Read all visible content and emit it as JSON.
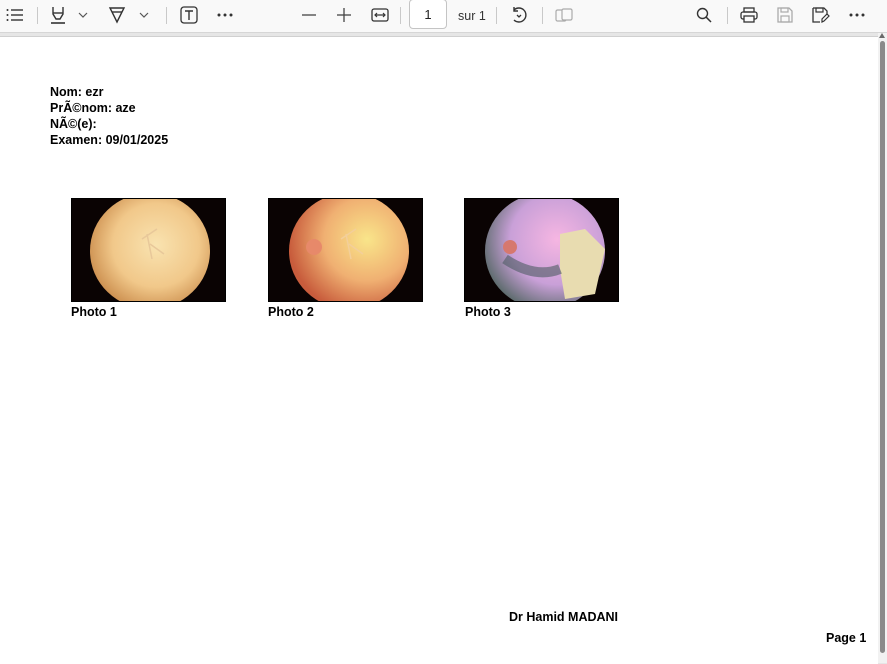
{
  "toolbar": {
    "icons": [
      "contents-icon",
      "highlight-icon",
      "chevron-down-icon",
      "draw-icon",
      "chevron-down-icon",
      "text-box-icon",
      "more-tools-icon",
      "zoom-out-icon",
      "zoom-in-icon",
      "fit-width-icon",
      "rotate-icon",
      "page-view-icon",
      "search-icon",
      "print-icon",
      "save-icon",
      "save-as-icon",
      "more-icon"
    ],
    "page_current": "1",
    "page_total_label": "sur 1"
  },
  "document": {
    "nom": "Nom: ezr",
    "prenom": "PrÃ©nom: aze",
    "ne": "NÃ©(e):",
    "examen": "Examen: 09/01/2025",
    "photos": [
      {
        "caption": "Photo 1"
      },
      {
        "caption": "Photo 2"
      },
      {
        "caption": "Photo 3"
      }
    ],
    "doctor": "Dr Hamid MADANI",
    "page_label": "Page 1"
  }
}
